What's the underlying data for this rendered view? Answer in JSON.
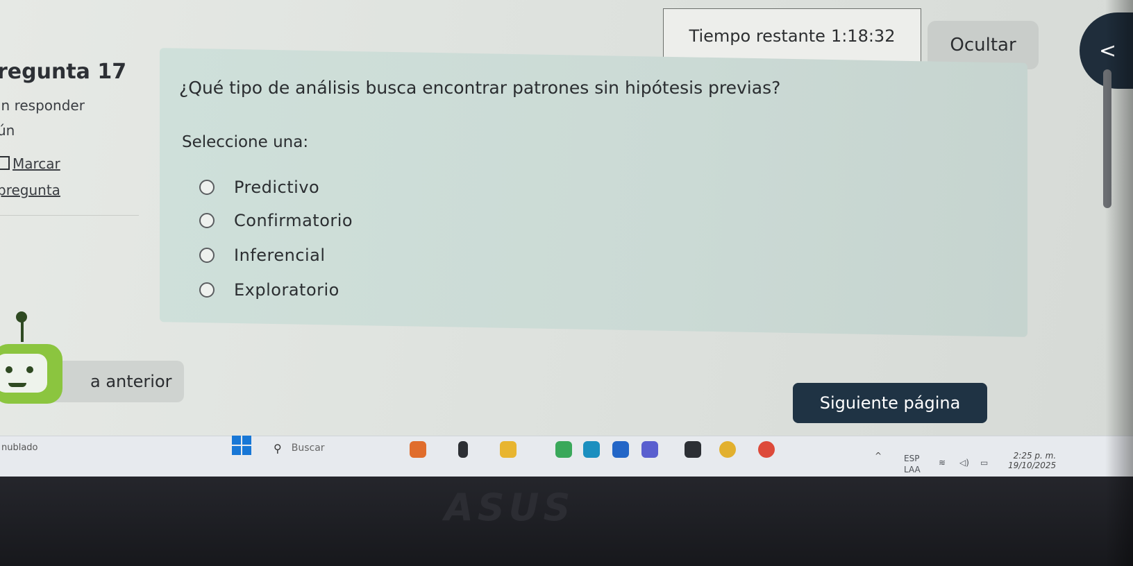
{
  "timer": {
    "label": "Tiempo restante",
    "value": "1:18:32"
  },
  "hide_button": "Ocultar",
  "drawer_toggle": "<",
  "info": {
    "question_number": "regunta 17",
    "status_line1": "in responder",
    "status_line2": "ún",
    "flag_label": "Marcar",
    "flag_label2": "pregunta"
  },
  "question": {
    "text": "¿Qué tipo de análisis busca encontrar patrones sin hipótesis previas?",
    "select_label": "Seleccione una:",
    "options": [
      "Predictivo",
      "Confirmatorio",
      "Inferencial",
      "Exploratorio"
    ]
  },
  "nav": {
    "prev_label": "a anterior",
    "next_label": "Siguiente página"
  },
  "taskbar": {
    "weather": "nublado",
    "search_placeholder": "Buscar",
    "lang1": "ESP",
    "lang2": "LAA",
    "time": "2:25 p. m.",
    "date": "19/10/2025"
  },
  "brand": "ASUS",
  "colors": {
    "accent": "#1f3344",
    "card": "#cfe0da",
    "bot": "#8bc53f"
  }
}
